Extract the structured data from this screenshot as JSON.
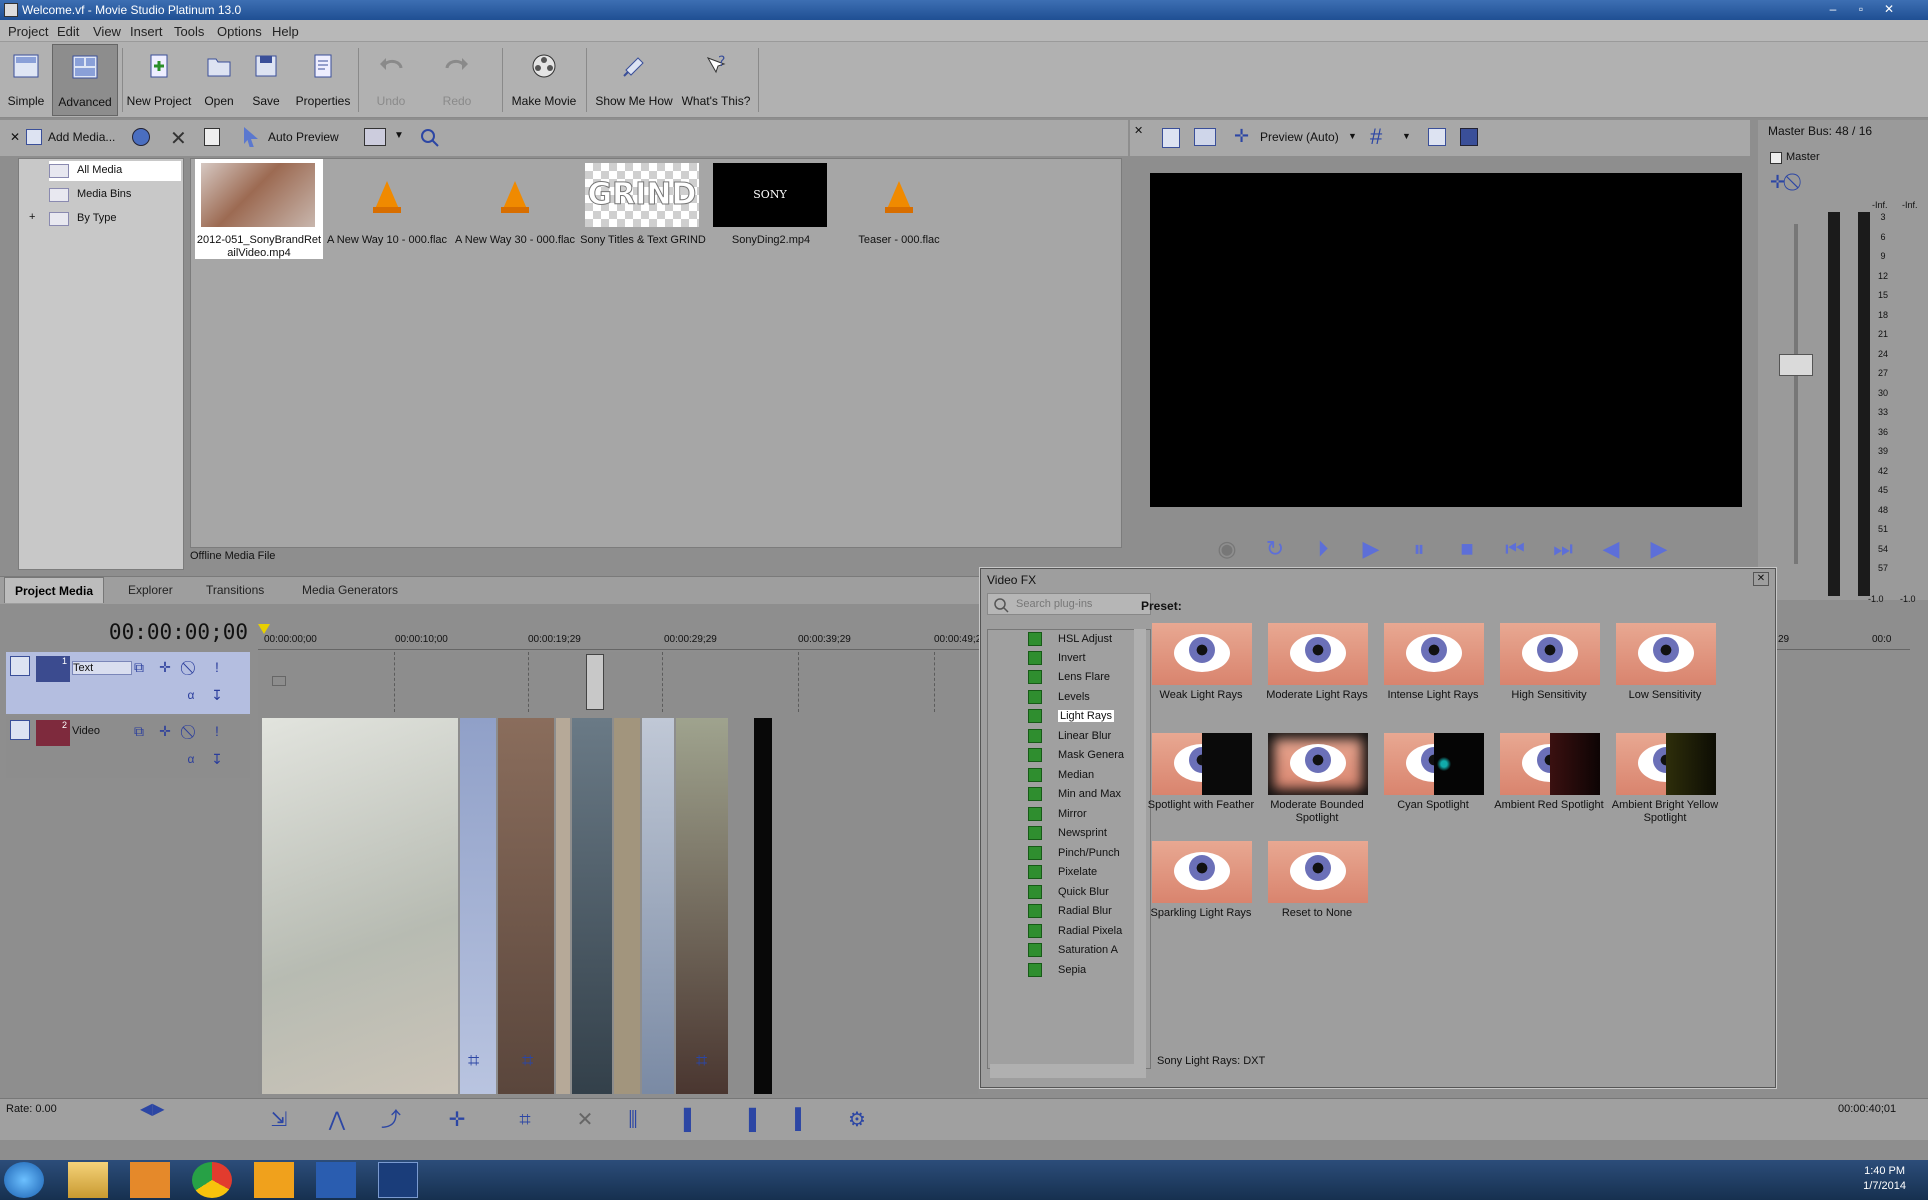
{
  "window": {
    "title": "Welcome.vf - Movie Studio Platinum 13.0",
    "minimize": "–",
    "maximize": "▫",
    "close": "✕"
  },
  "menu": [
    "Project",
    "Edit",
    "View",
    "Insert",
    "Tools",
    "Options",
    "Help"
  ],
  "toolbar": {
    "simple": "Simple",
    "advanced": "Advanced",
    "new_project": "New Project",
    "open": "Open",
    "save": "Save",
    "properties": "Properties",
    "undo": "Undo",
    "redo": "Redo",
    "make_movie": "Make Movie",
    "show_me_how": "Show Me How",
    "whats_this": "What's This?"
  },
  "media_toolbar": {
    "add_media": "Add Media...",
    "auto_preview": "Auto Preview"
  },
  "media_tree": {
    "all_media": "All Media",
    "media_bins": "Media Bins",
    "by_type": "By Type",
    "expand": "+"
  },
  "media_items": [
    {
      "name": "2012-051_SonyBrandRet ailVideo.mp4"
    },
    {
      "name": "A New Way 10 - 000.flac"
    },
    {
      "name": "A New Way 30 - 000.flac"
    },
    {
      "name": "Sony Titles & Text GRIND",
      "thumb_text": "GRIND"
    },
    {
      "name": "SonyDing2.mp4",
      "thumb_text": "SONY"
    },
    {
      "name": "Teaser - 000.flac"
    }
  ],
  "media_status": "Offline Media File",
  "tabs": [
    "Project Media",
    "Explorer",
    "Transitions",
    "Media Generators"
  ],
  "preview": {
    "mode": "Preview (Auto)"
  },
  "master": {
    "title": "Master Bus: 48 / 16",
    "name": "Master",
    "inf_left": "-Inf.",
    "inf_right": "-Inf.",
    "scale": [
      "3",
      "6",
      "9",
      "12",
      "15",
      "18",
      "21",
      "24",
      "27",
      "30",
      "33",
      "36",
      "39",
      "42",
      "45",
      "48",
      "51",
      "54",
      "57"
    ],
    "bottom_left": "-1.0",
    "bottom_right": "-1.0"
  },
  "timeline": {
    "timecode": "00:00:00;00",
    "ruler": [
      "00:00:00;00",
      "00:00:10;00",
      "00:00:19;29",
      "00:00:29;29",
      "00:00:39;29",
      "00:00:49;2",
      "29",
      "00:0"
    ],
    "tracks": [
      {
        "num": "1",
        "name": "Text"
      },
      {
        "num": "2",
        "name": "Video"
      }
    ],
    "rate": "Rate: 0.00",
    "end_time": "00:00:40;01"
  },
  "video_fx": {
    "title": "Video FX",
    "close": "✕",
    "search_placeholder": "Search plug-ins",
    "preset_label": "Preset:",
    "plugins": [
      "HSL Adjust",
      "Invert",
      "Lens Flare",
      "Levels",
      "Light Rays",
      "Linear Blur",
      "Mask Genera",
      "Median",
      "Min and Max",
      "Mirror",
      "Newsprint",
      "Pinch/Punch",
      "Pixelate",
      "Quick Blur",
      "Radial Blur",
      "Radial Pixela",
      "Saturation A",
      "Sepia"
    ],
    "selected_plugin": "Light Rays",
    "presets": [
      "Weak Light Rays",
      "Moderate Light Rays",
      "Intense Light Rays",
      "High Sensitivity",
      "Low Sensitivity",
      "Spotlight with Feather",
      "Moderate Bounded Spotlight",
      "Cyan Spotlight",
      "Ambient Red Spotlight",
      "Ambient Bright Yellow Spotlight",
      "Sparkling Light Rays",
      "Reset to None"
    ],
    "description": "Sony Light Rays: DXT"
  },
  "clock": {
    "time": "1:40 PM",
    "date": "1/7/2014"
  },
  "colors": {
    "accent": "#3d6fb3",
    "preset_selected_bg": "#ffffff",
    "icon_blue": "#2c46a4",
    "flac_cone": "#f08a00"
  },
  "icons": [
    "search-icon",
    "gear-icon",
    "play-icon",
    "stop-icon",
    "pause-icon",
    "loop-icon",
    "crop-icon",
    "delete-icon"
  ]
}
